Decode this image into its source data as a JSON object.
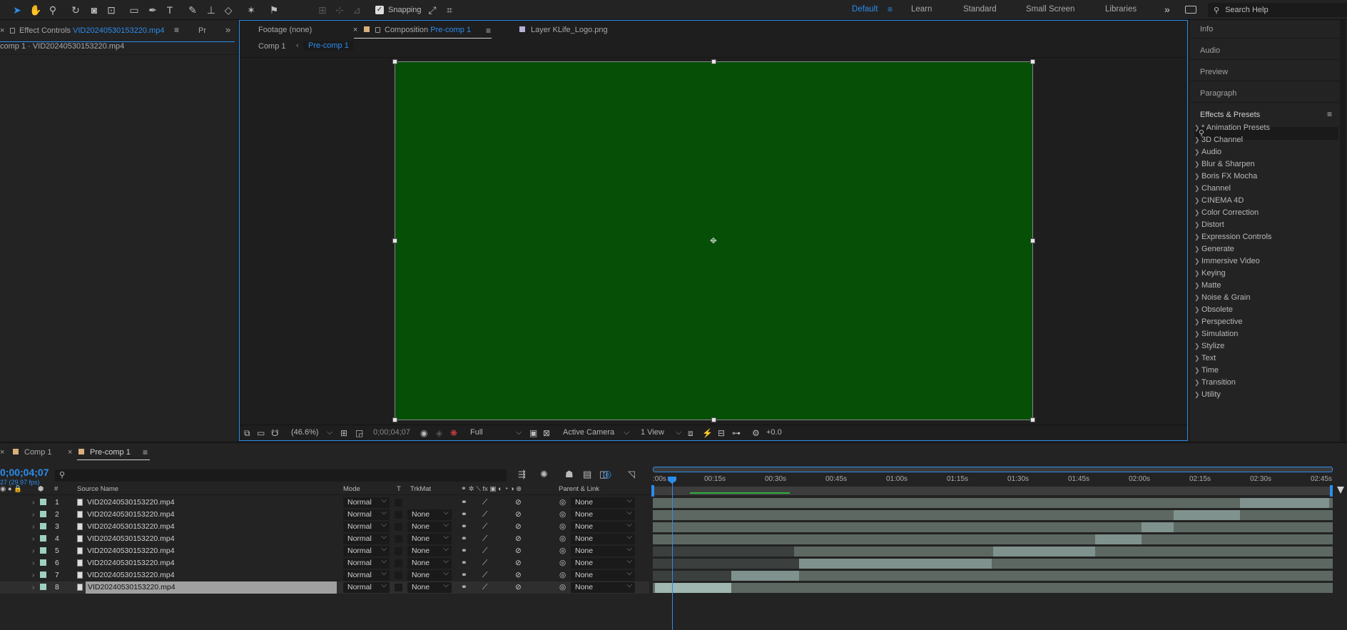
{
  "toolbar": {
    "snapping_label": "Snapping",
    "workspaces": [
      "Default",
      "Learn",
      "Standard",
      "Small Screen",
      "Libraries"
    ],
    "active_workspace": "Default",
    "search_placeholder": "Search Help",
    "more_chevron": "»"
  },
  "left_panel": {
    "tab_effect_controls": "Effect Controls",
    "tab_effect_controls_file": "VID20240530153220.mp4",
    "tab_project_short": "Pr",
    "subtitle": "comp 1 · VID20240530153220.mp4"
  },
  "viewer": {
    "tabs": [
      {
        "label": "Footage",
        "value": "(none)"
      },
      {
        "label": "Composition",
        "value": "Pre-comp 1"
      },
      {
        "label": "Layer",
        "value": "KLife_Logo.png"
      }
    ],
    "breadcrumbs": [
      "Comp 1",
      "Pre-comp 1"
    ],
    "canvas_color": "#054f07",
    "zoom": "(46.6%)",
    "timecode": "0;00;04;07",
    "resolution": "Full",
    "camera": "Active Camera",
    "view": "1 View",
    "exposure": "+0.0"
  },
  "right_panel": {
    "sections": [
      "Info",
      "Audio",
      "Preview",
      "Paragraph"
    ],
    "effects_title": "Effects & Presets",
    "effects_search_placeholder": "",
    "categories": [
      "* Animation Presets",
      "3D Channel",
      "Audio",
      "Blur & Sharpen",
      "Boris FX Mocha",
      "Channel",
      "CINEMA 4D",
      "Color Correction",
      "Distort",
      "Expression Controls",
      "Generate",
      "Immersive Video",
      "Keying",
      "Matte",
      "Noise & Grain",
      "Obsolete",
      "Perspective",
      "Simulation",
      "Stylize",
      "Text",
      "Time",
      "Transition",
      "Utility"
    ]
  },
  "timeline": {
    "tabs": [
      "Comp 1",
      "Pre-comp 1"
    ],
    "current_time": "0;00;04;07",
    "frame_info": "27 (29.97 fps)",
    "headers": {
      "num": "#",
      "source": "Source Name",
      "mode": "Mode",
      "t": "T",
      "trkmat": "TrkMat",
      "parent": "Parent & Link"
    },
    "ruler": [
      ":00s",
      "00:15s",
      "00:30s",
      "00:45s",
      "01:00s",
      "01:15s",
      "01:30s",
      "01:45s",
      "02:00s",
      "02:15s",
      "02:30s",
      "02:45s"
    ],
    "layers": [
      {
        "num": "1",
        "name": "VID20240530153220.mp4",
        "mode": "Normal",
        "trkmat": "",
        "parent": "None"
      },
      {
        "num": "2",
        "name": "VID20240530153220.mp4",
        "mode": "Normal",
        "trkmat": "None",
        "parent": "None"
      },
      {
        "num": "3",
        "name": "VID20240530153220.mp4",
        "mode": "Normal",
        "trkmat": "None",
        "parent": "None"
      },
      {
        "num": "4",
        "name": "VID20240530153220.mp4",
        "mode": "Normal",
        "trkmat": "None",
        "parent": "None"
      },
      {
        "num": "5",
        "name": "VID20240530153220.mp4",
        "mode": "Normal",
        "trkmat": "None",
        "parent": "None"
      },
      {
        "num": "6",
        "name": "VID20240530153220.mp4",
        "mode": "Normal",
        "trkmat": "None",
        "parent": "None"
      },
      {
        "num": "7",
        "name": "VID20240530153220.mp4",
        "mode": "Normal",
        "trkmat": "None",
        "parent": "None"
      },
      {
        "num": "8",
        "name": "VID20240530153220.mp4",
        "mode": "Normal",
        "trkmat": "None",
        "parent": "None"
      }
    ]
  }
}
